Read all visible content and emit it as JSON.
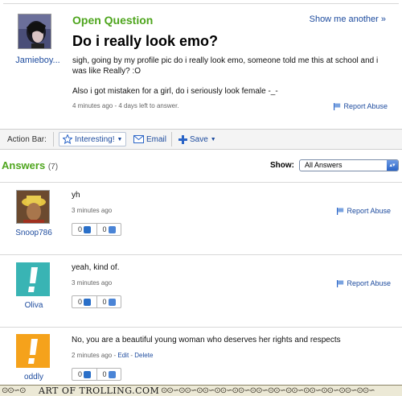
{
  "question": {
    "label": "Open Question",
    "show_another": "Show me another »",
    "title": "Do i really look emo?",
    "asker": "Jamieboy...",
    "body": [
      "sigh, going by my profile pic do i really look emo, someone told me this at school and i was like Really? :O",
      "Also i got mistaken for a girl, do i seriously look female -_-"
    ],
    "meta": "4 minutes ago - 4 days left to answer.",
    "report": "Report Abuse"
  },
  "action_bar": {
    "label": "Action Bar:",
    "interesting": "Interesting!",
    "email": "Email",
    "save": "Save"
  },
  "answers_header": {
    "title": "Answers",
    "count": "(7)",
    "show_label": "Show:",
    "show_value": "All Answers"
  },
  "answers": [
    {
      "name": "Snoop786",
      "text": "yh",
      "meta": "3 minutes ago",
      "edit": "",
      "delete": "",
      "up": "0",
      "down": "0",
      "report": "Report Abuse"
    },
    {
      "name": "Oliva",
      "text": "yeah, kind of.",
      "meta": "3 minutes ago",
      "edit": "",
      "delete": "",
      "up": "0",
      "down": "0",
      "report": "Report Abuse"
    },
    {
      "name": "oddly",
      "text": "No, you are a beautiful young woman who deserves her rights and respects",
      "meta": "2 minutes ago - ",
      "edit": "Edit",
      "delete": "Delete",
      "up": "0",
      "down": "0",
      "report": ""
    }
  ],
  "footer": {
    "text": "ART OF TROLLING.COM"
  },
  "colors": {
    "green": "#4ea51d",
    "link": "#1d4b9e",
    "oliva_avatar": "#39b4b4",
    "oddly_avatar": "#f5a21b"
  }
}
